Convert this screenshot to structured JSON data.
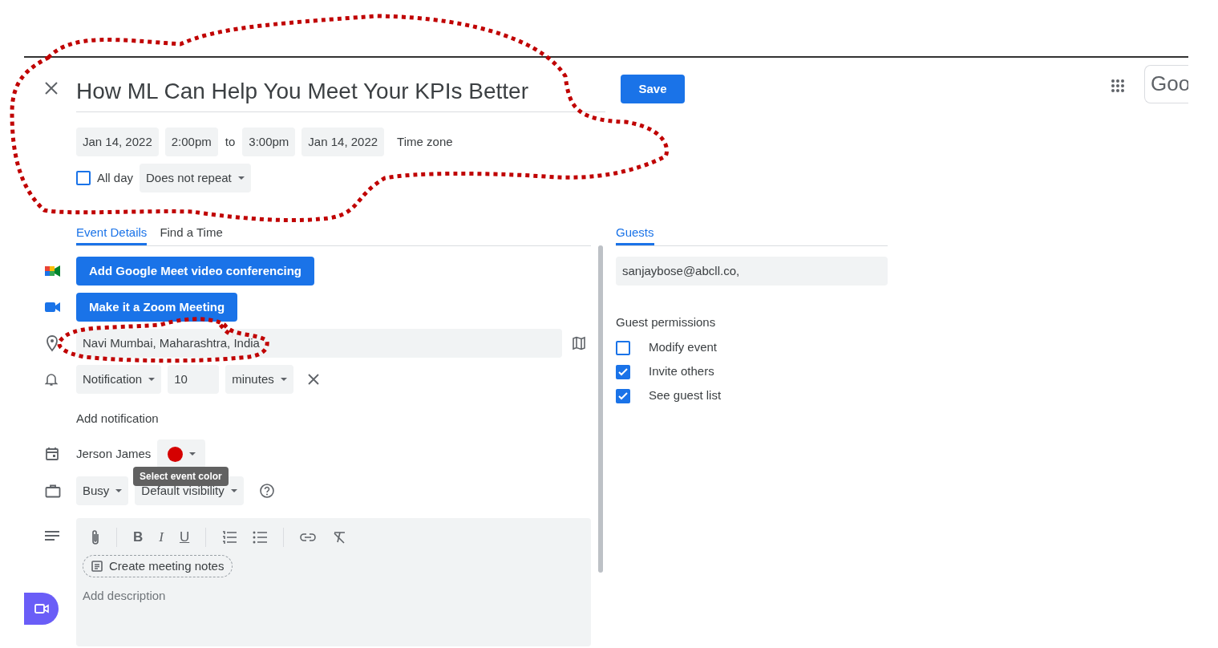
{
  "title": "How ML Can Help You Meet Your KPIs Better",
  "save_button": "Save",
  "logo_text": "Goo",
  "when": {
    "start_date": "Jan 14, 2022",
    "start_time": "2:00pm",
    "to_label": "to",
    "end_time": "3:00pm",
    "end_date": "Jan 14, 2022",
    "time_zone": "Time zone"
  },
  "all_day": {
    "label": "All day",
    "checked": false
  },
  "repeat": "Does not repeat",
  "tabs": [
    {
      "label": "Event Details",
      "selected": true
    },
    {
      "label": "Find a Time",
      "selected": false
    }
  ],
  "meet_button": "Add Google Meet video conferencing",
  "zoom_button": "Make it a Zoom Meeting",
  "location": "Navi Mumbai, Maharashtra, India",
  "notification": {
    "type": "Notification",
    "value": "10",
    "unit": "minutes"
  },
  "add_notification": "Add notification",
  "calendar_owner": "Jerson James",
  "event_color": {
    "color": "#d50000"
  },
  "tooltip": "Select event color",
  "availability": "Busy",
  "visibility": "Default visibility",
  "format_buttons": [
    "B",
    "I",
    "U"
  ],
  "create_notes": "Create meeting notes",
  "description_placeholder": "Add description",
  "guest_tabs": [
    {
      "label": "Guests",
      "selected": true
    }
  ],
  "guest_input": "sanjaybose@abcll.co,",
  "permissions_title": "Guest permissions",
  "permissions": [
    {
      "label": "Modify event",
      "checked": false
    },
    {
      "label": "Invite others",
      "checked": true
    },
    {
      "label": "See guest list",
      "checked": true
    }
  ]
}
